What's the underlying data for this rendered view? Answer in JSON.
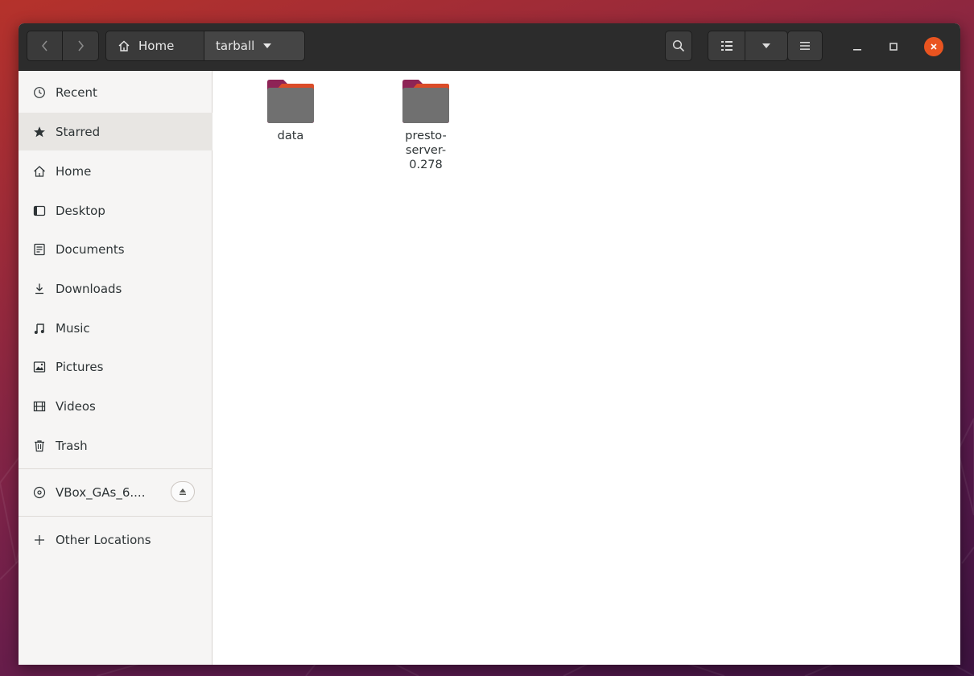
{
  "toolbar": {
    "back_icon": "chevron-left-icon",
    "forward_icon": "chevron-right-icon",
    "path": [
      {
        "label": "Home",
        "icon": "home-icon"
      },
      {
        "label": "tarball",
        "icon": "chevron-down-icon"
      }
    ],
    "search_icon": "search-icon",
    "view_icon": "list-view-icon",
    "menu_icon": "hamburger-menu-icon",
    "accent_color": "#e95420"
  },
  "sidebar": {
    "items": [
      {
        "label": "Recent",
        "icon": "clock-icon"
      },
      {
        "label": "Starred",
        "icon": "star-icon",
        "selected": true
      },
      {
        "label": "Home",
        "icon": "home-icon"
      },
      {
        "label": "Desktop",
        "icon": "desktop-icon"
      },
      {
        "label": "Documents",
        "icon": "document-icon"
      },
      {
        "label": "Downloads",
        "icon": "download-icon"
      },
      {
        "label": "Music",
        "icon": "music-note-icon"
      },
      {
        "label": "Pictures",
        "icon": "picture-icon"
      },
      {
        "label": "Videos",
        "icon": "video-icon"
      },
      {
        "label": "Trash",
        "icon": "trash-icon"
      }
    ],
    "devices": [
      {
        "label": "VBox_GAs_6....",
        "icon": "disc-icon",
        "eject_icon": "eject-icon"
      }
    ],
    "other_locations": {
      "label": "Other Locations",
      "icon": "plus-icon"
    }
  },
  "files": [
    {
      "name": "data",
      "type": "folder"
    },
    {
      "name": "presto-\nserver-\n0.278",
      "type": "folder"
    }
  ]
}
